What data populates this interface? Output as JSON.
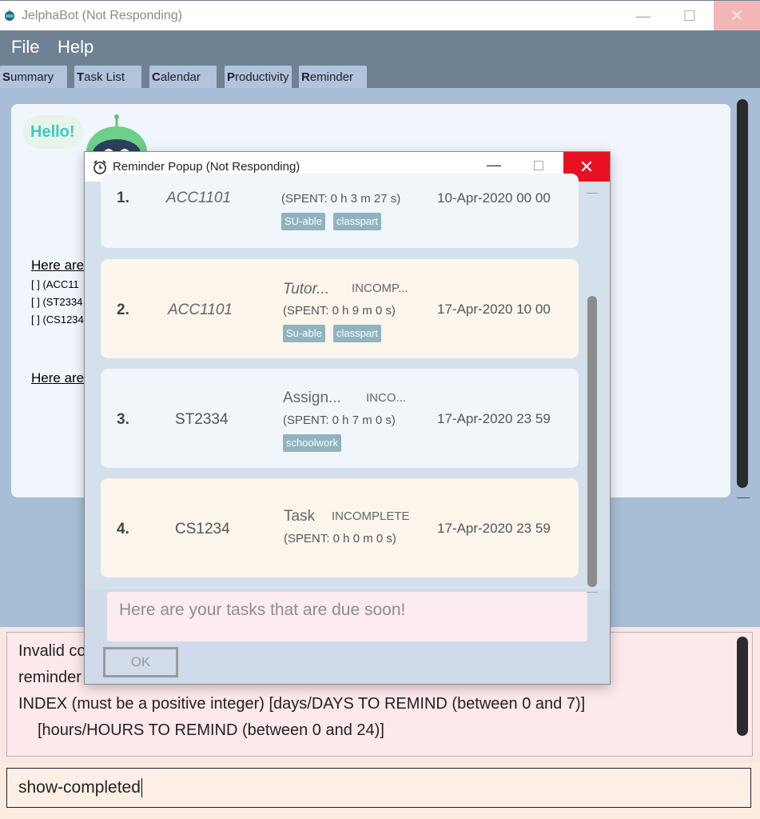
{
  "window": {
    "title": "JelphaBot (Not Responding)",
    "minimize_glyph": "—",
    "maximize_glyph": "☐",
    "close_glyph": "✕"
  },
  "menu": {
    "file": "File",
    "help": "Help"
  },
  "tabs": [
    {
      "key": "S",
      "rest": "ummary"
    },
    {
      "key": "T",
      "rest": "ask List"
    },
    {
      "key": "C",
      "rest": "alendar"
    },
    {
      "key": "P",
      "rest": "roductivity"
    },
    {
      "key": "R",
      "rest": "eminder"
    }
  ],
  "summary": {
    "hello_text": "Hello!",
    "heading1": "Here are",
    "lines": [
      "[ ] (ACC11",
      "[ ] (ST2334",
      "[ ] (CS1234"
    ],
    "heading2": "Here are"
  },
  "feedback": {
    "line1": "Invalid co",
    "line2": "reminder",
    "line3": "INDEX (must be a positive integer)      [days/DAYS TO REMIND (between 0 and 7)]",
    "line4": "[hours/HOURS TO REMIND (between 0 and 24)]"
  },
  "command": {
    "value": "show-completed"
  },
  "popup": {
    "title": "Reminder Popup (Not Responding)",
    "minimize_glyph": "—",
    "close_glyph": "✕",
    "message": "Here are your tasks that are due soon!",
    "ok_label": "OK",
    "tasks": [
      {
        "index": "1.",
        "module": "ACC1101",
        "name": "",
        "status": "",
        "spent": "(SPENT: 0 h 3 m 27 s)",
        "date": "10-Apr-2020 00 00",
        "tags": [
          "SU-able",
          "classpart"
        ]
      },
      {
        "index": "2.",
        "module": "ACC1101",
        "name": "Tutor...",
        "status": "INCOMP...",
        "spent": "(SPENT: 0 h 9 m 0 s)",
        "date": "17-Apr-2020 10 00",
        "tags": [
          "Su-able",
          "classpart"
        ]
      },
      {
        "index": "3.",
        "module": "ST2334",
        "name": "Assign...",
        "status": "INCO...",
        "spent": "(SPENT: 0 h 7 m 0 s)",
        "date": "17-Apr-2020 23 59",
        "tags": [
          "schoolwork"
        ]
      },
      {
        "index": "4.",
        "module": "CS1234",
        "name": "Task",
        "status": "INCOMPLETE",
        "spent": "(SPENT: 0 h 0 m 0 s)",
        "date": "17-Apr-2020 23 59",
        "tags": []
      }
    ]
  },
  "colors": {
    "accent": "#6f8294",
    "tab_bg": "#b1c4dc",
    "tag_bg": "#8fb3bf",
    "close_red": "#e81123"
  }
}
